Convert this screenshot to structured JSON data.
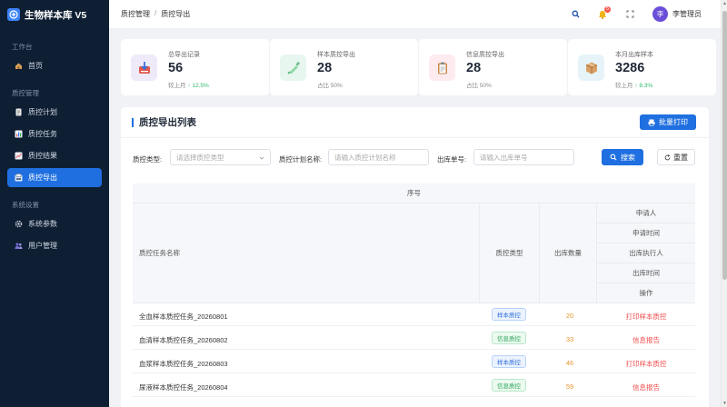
{
  "brand": {
    "title": "生物样本库 V5",
    "icon": "plus-circle-icon"
  },
  "sidebar": {
    "groups": [
      {
        "label": "工作台",
        "items": [
          {
            "label": "首页",
            "icon": "home-icon",
            "active": false
          }
        ]
      },
      {
        "label": "质控管理",
        "items": [
          {
            "label": "质控计划",
            "icon": "document-icon",
            "active": false
          },
          {
            "label": "质控任务",
            "icon": "bar-chart-icon",
            "active": false
          },
          {
            "label": "质控结果",
            "icon": "line-chart-icon",
            "active": false
          },
          {
            "label": "质控导出",
            "icon": "export-icon",
            "active": true
          }
        ]
      },
      {
        "label": "系统设置",
        "items": [
          {
            "label": "系统参数",
            "icon": "gear-icon",
            "active": false
          },
          {
            "label": "用户管理",
            "icon": "users-icon",
            "active": false
          }
        ]
      }
    ]
  },
  "header": {
    "breadcrumb": [
      "质控管理",
      "质控导出"
    ],
    "notification_count": "5",
    "avatar_text": "李",
    "user_name": "李管理员"
  },
  "stats": [
    {
      "title": "总导出记录",
      "value": "56",
      "sub_prefix": "较上月",
      "sub_trend": "↑ 12.5%",
      "icon": "export-box-icon",
      "icon_bg": "#eeeaf9"
    },
    {
      "title": "样本质控导出",
      "value": "28",
      "sub_prefix": "占比 50%",
      "sub_trend": "",
      "icon": "syringe-icon",
      "icon_bg": "#e7f6ee"
    },
    {
      "title": "信息质控导出",
      "value": "28",
      "sub_prefix": "占比 50%",
      "sub_trend": "",
      "icon": "clipboard-icon",
      "icon_bg": "#fdebf0"
    },
    {
      "title": "本月出库样本",
      "value": "3286",
      "sub_prefix": "较上月",
      "sub_trend": "↑ 8.3%",
      "icon": "package-icon",
      "icon_bg": "#e6f4fa"
    }
  ],
  "panel": {
    "title": "质控导出列表",
    "batch_print_label": "批量打印",
    "filters": {
      "type_label": "质控类型:",
      "type_placeholder": "请选择质控类型",
      "plan_label": "质控计划名称:",
      "plan_placeholder": "请输入质控计划名称",
      "order_label": "出库单号:",
      "order_placeholder": "请输入出库单号"
    },
    "search_label": "搜索",
    "reset_label": "重置"
  },
  "table": {
    "header_top": "序号",
    "col_name": "质控任务名称",
    "col_type": "质控类型",
    "col_qty": "出库数量",
    "col_right": [
      "申请人",
      "申请时间",
      "出库执行人",
      "出库时间",
      "操作"
    ],
    "rows": [
      {
        "name": "全血样本质控任务_20260801",
        "type": "样本质控",
        "type_color": "blue",
        "qty": "20",
        "action": "打印样本质控"
      },
      {
        "name": "血清样本质控任务_20260802",
        "type": "信息质控",
        "type_color": "green",
        "qty": "33",
        "action": "信息报告"
      },
      {
        "name": "血浆样本质控任务_20260803",
        "type": "样本质控",
        "type_color": "blue",
        "qty": "46",
        "action": "打印样本质控"
      },
      {
        "name": "尿液样本质控任务_20260804",
        "type": "信息质控",
        "type_color": "green",
        "qty": "59",
        "action": "信息报告"
      }
    ]
  }
}
